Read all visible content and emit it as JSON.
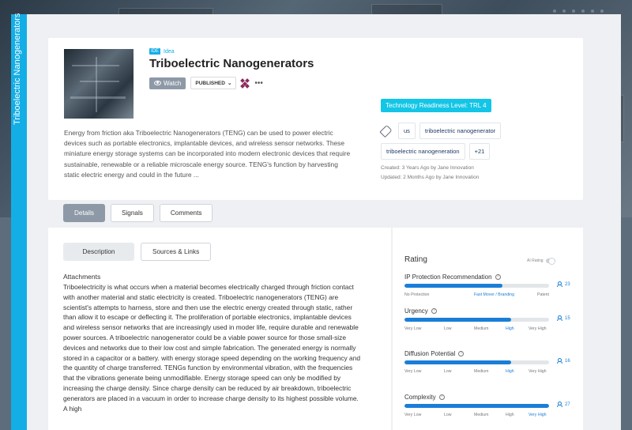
{
  "sidebar": {
    "title": "Triboelectric Nanogenerators"
  },
  "header": {
    "type_icon": "IDE",
    "type_label": "Idea",
    "title": "Triboelectric Nanogenerators",
    "watch_label": "Watch",
    "status_label": "PUBLISHED",
    "more_label": "•••",
    "description": "Energy from friction aka Triboelectric Nanogenerators (TENG) can be used to power electric devices such as portable electronics, implantable devices, and wireless sensor networks. These miniature energy storage systems can be incorporated into modern electronic devices that require sustainable, renewable or a reliable microscale energy source. TENG's function by harvesting static electric energy and could in the future ...",
    "trl_badge": "Technology Readiness Level: TRL 4",
    "tags": [
      "us",
      "triboelectric nanogenerator",
      "triboelectric nanogeneration",
      "+21"
    ],
    "created": "Created: 3 Years Ago by Jane Innovation",
    "updated": "Updated: 2 Months Ago by Jane Innovation"
  },
  "tabs": [
    "Details",
    "Signals",
    "Comments"
  ],
  "subtabs": [
    "Description",
    "Sources & Links"
  ],
  "main": {
    "attachments_heading": "Attachments",
    "body": "Triboelectricity is what occurs when a material becomes electrically charged through friction contact with another material and static electricity is created. Triboelectric nanogenerators (TENG) are scientist's attempts to harness, store and then use the electric energy created through static, rather than allow it to escape or deflecting it. The proliferation of portable electronics, implantable devices and wireless sensor networks that are increasingly used in moder life, require durable and renewable power sources. A triboelectric nanogenerator could be a viable power source for those small-size devices and networks due to their low cost and simple fabrication. The generated energy is normally stored in a capacitor or a battery. with energy storage speed depending on the working frequency and the quantity of charge transferred. TENGs function by environmental vibration, with the frequencies that the vibrations generate being unmodifiable. Energy storage speed can only be modified by increasing the charge density. Since charge density can be reduced by air breakdown, triboelectric generators are placed in a vacuum in order to increase charge density to its highest possible volume. A high"
  },
  "rating": {
    "title": "Rating",
    "ai_label": "AI Rating",
    "metrics": [
      {
        "label": "IP Protection Recommendation",
        "fill": 0.68,
        "count": "23",
        "scale": [
          "No Protection",
          "Fast Mover / Branding",
          "Patent"
        ],
        "selected": 1
      },
      {
        "label": "Urgency",
        "fill": 0.74,
        "count": "15",
        "scale": [
          "Very Low",
          "Low",
          "Medium",
          "High",
          "Very High"
        ],
        "selected": 3
      },
      {
        "label": "Diffusion Potential",
        "fill": 0.74,
        "count": "16",
        "scale": [
          "Very Low",
          "Low",
          "Medium",
          "High",
          "Very High"
        ],
        "selected": 3
      },
      {
        "label": "Complexity",
        "fill": 1.0,
        "count": "27",
        "scale": [
          "Very Low",
          "Low",
          "Medium",
          "High",
          "Very High"
        ],
        "selected": 4
      }
    ]
  },
  "colors": {
    "accent": "#13aee6",
    "bar": "#1a7ed8",
    "trl": "#13c5e6"
  }
}
